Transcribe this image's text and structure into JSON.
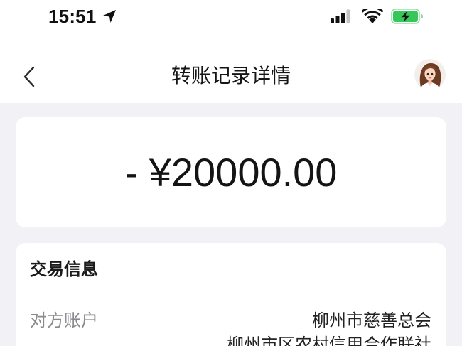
{
  "status_bar": {
    "time": "15:51",
    "icons": [
      "location-arrow-icon",
      "cellular-signal-icon",
      "wifi-icon",
      "battery-charging-icon"
    ]
  },
  "nav": {
    "back_icon": "chevron-left-icon",
    "title": "转账记录详情",
    "avatar_icon": "avatar-woman"
  },
  "amount": {
    "text": "- ¥20000.00"
  },
  "transaction": {
    "section_title": "交易信息",
    "rows": [
      {
        "label": "对方账户",
        "values": [
          "柳州市慈善总会",
          "柳州市区农村信用合作联社"
        ]
      }
    ]
  },
  "theme": {
    "battery_fill": "#35c759",
    "content_background": "#f2f2f6",
    "card_background": "#ffffff"
  }
}
